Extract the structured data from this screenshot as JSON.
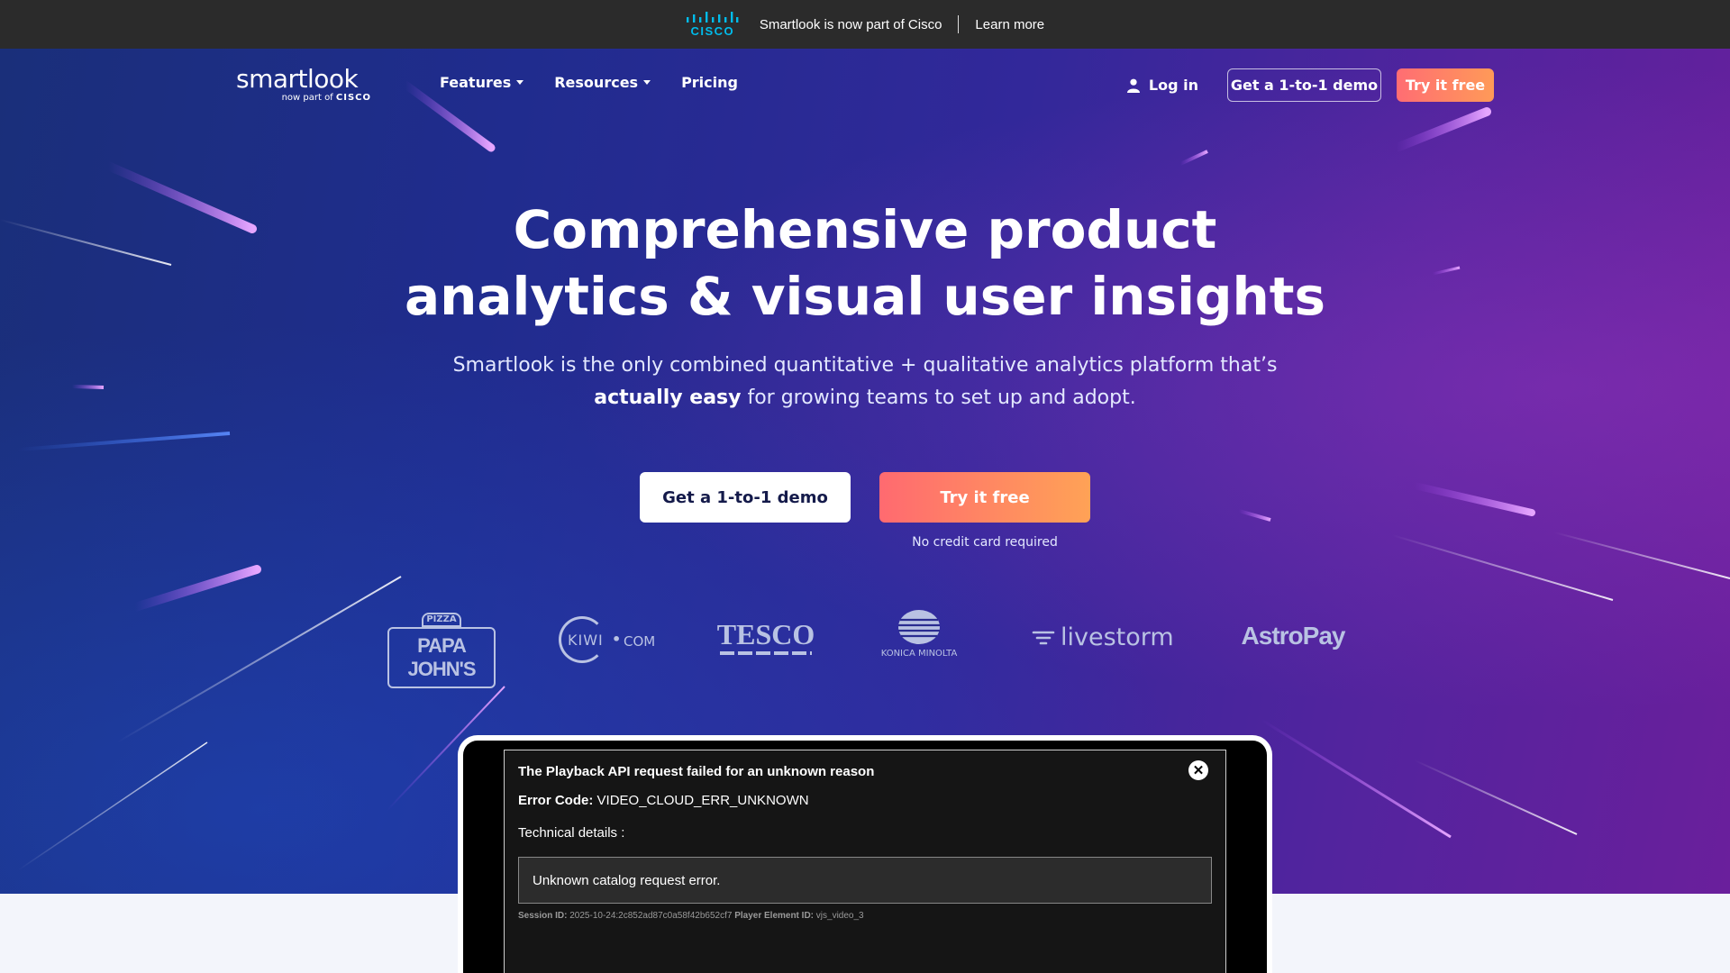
{
  "announcement": {
    "cisco_label": "CISCO",
    "text": "Smartlook is now part of Cisco",
    "link": "Learn more"
  },
  "brand": {
    "name": "smartlook",
    "sub_prefix": "now part of",
    "sub_brand": "CISCO"
  },
  "nav": {
    "items": [
      {
        "label": "Features",
        "has_dropdown": true
      },
      {
        "label": "Resources",
        "has_dropdown": true
      },
      {
        "label": "Pricing",
        "has_dropdown": false
      }
    ],
    "login": "Log in",
    "demo_button": "Get a 1-to-1 demo",
    "try_button": "Try it free"
  },
  "hero": {
    "headline_line1": "Comprehensive product",
    "headline_line2": "analytics & visual user insights",
    "sub_line1": "Smartlook is the only combined quantitative + qualitative analytics platform that’s",
    "sub_bold": "actually easy",
    "sub_line2_rest": " for growing teams to set up and adopt.",
    "cta_demo": "Get a 1-to-1 demo",
    "cta_try": "Try it free",
    "no_credit_card": "No credit card required"
  },
  "logos": {
    "papa_top": "PIZZA",
    "papa": "PAPA JOHN'S",
    "kiwi_left": "KIWI",
    "kiwi_right": "COM",
    "tesco": "TESCO",
    "konica": "KONICA MINOLTA",
    "livestorm": "livestorm",
    "astropay": "AstroPay"
  },
  "player_error": {
    "title": "The Playback API request failed for an unknown reason",
    "code_label": "Error Code:",
    "code_value": "VIDEO_CLOUD_ERR_UNKNOWN",
    "technical_label": "Technical details :",
    "detail": "Unknown catalog request error.",
    "session_label": "Session ID:",
    "session_value": "2025-10-24:2c852ad87c0a58f42b652cf7",
    "element_label": "Player Element ID:",
    "element_value": "vjs_video_3",
    "close_glyph": "✕"
  },
  "colors": {
    "topbar_bg": "#2b2b2b",
    "hero_start": "#1a2f7a",
    "hero_end": "#6a1f9c",
    "accent_orange_start": "#ff6a70",
    "accent_orange_end": "#ffa256",
    "cisco_blue": "#00bceb"
  }
}
